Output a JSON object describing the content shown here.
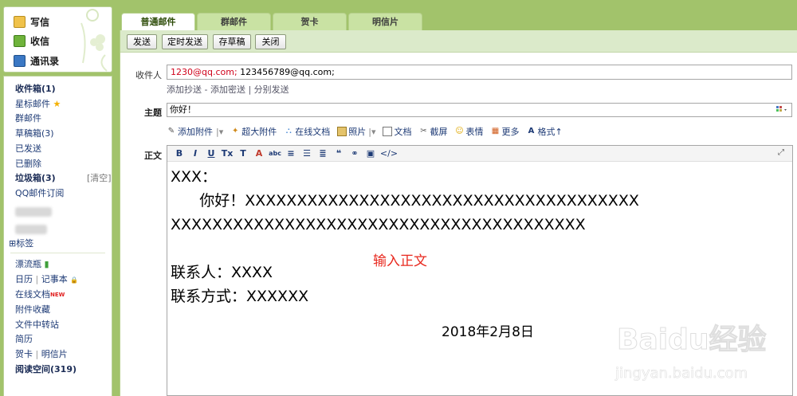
{
  "sidebar": {
    "quick": [
      {
        "label": "写信",
        "icon": "write-icon"
      },
      {
        "label": "收信",
        "icon": "inbox-download-icon"
      },
      {
        "label": "通讯录",
        "icon": "contacts-icon"
      }
    ],
    "folders": {
      "inbox": "收件箱(1)",
      "starred": "星标邮件",
      "group": "群邮件",
      "drafts": "草稿箱(3)",
      "sent": "已发送",
      "deleted": "已删除",
      "spam": "垃圾箱(3)",
      "spam_clear": "[清空]",
      "subscribe": "QQ邮件订阅",
      "tags": "标签"
    },
    "apps": {
      "bottle": "漂流瓶",
      "calendar": "日历",
      "divider1": "|",
      "notebook": "记事本",
      "docs": "在线文档",
      "docs_badge": "NEW",
      "attach_fav": "附件收藏",
      "transfer": "文件中转站",
      "resume": "简历",
      "card": "贺卡",
      "divider2": "|",
      "postcard": "明信片",
      "reading": "阅读空间(319)"
    }
  },
  "tabs": [
    "普通邮件",
    "群邮件",
    "贺卡",
    "明信片"
  ],
  "toolbar": {
    "send": "发送",
    "scheduled": "定时发送",
    "save_draft": "存草稿",
    "close": "关闭"
  },
  "compose": {
    "to_label": "收件人",
    "to_first": "1230@qq.com;",
    "to_second": "123456789@qq.com;",
    "cc_links": "添加抄送 - 添加密送 | 分别发送",
    "subject_label": "主题",
    "subject_value": "你好！",
    "body_label": "正文",
    "attach": {
      "add_attachment": "添加附件",
      "big_attachment": "超大附件",
      "online_doc": "在线文档",
      "photo": "照片",
      "doc": "文档",
      "screenshot": "截屏",
      "emoji": "表情",
      "more": "更多",
      "format": "格式"
    },
    "format_buttons": [
      "B",
      "I",
      "U",
      "Tx",
      "T",
      "A",
      "abc",
      "≡",
      "☰",
      "≣",
      "❝",
      "⚭",
      "▣",
      "</>"
    ],
    "body_lines": [
      "XXX：",
      "      你好！XXXXXXXXXXXXXXXXXXXXXXXXXXXXXXXXXXXXXX",
      "XXXXXXXXXXXXXXXXXXXXXXXXXXXXXXXXXXXXXXXX",
      "",
      "联系人：XXXX",
      "联系方式：XXXXXX"
    ],
    "hint_text": "输入正文",
    "date_text": "2018年2月8日"
  },
  "watermark": {
    "brand": "Baidu经验",
    "url": "jingyan.baidu.com"
  }
}
